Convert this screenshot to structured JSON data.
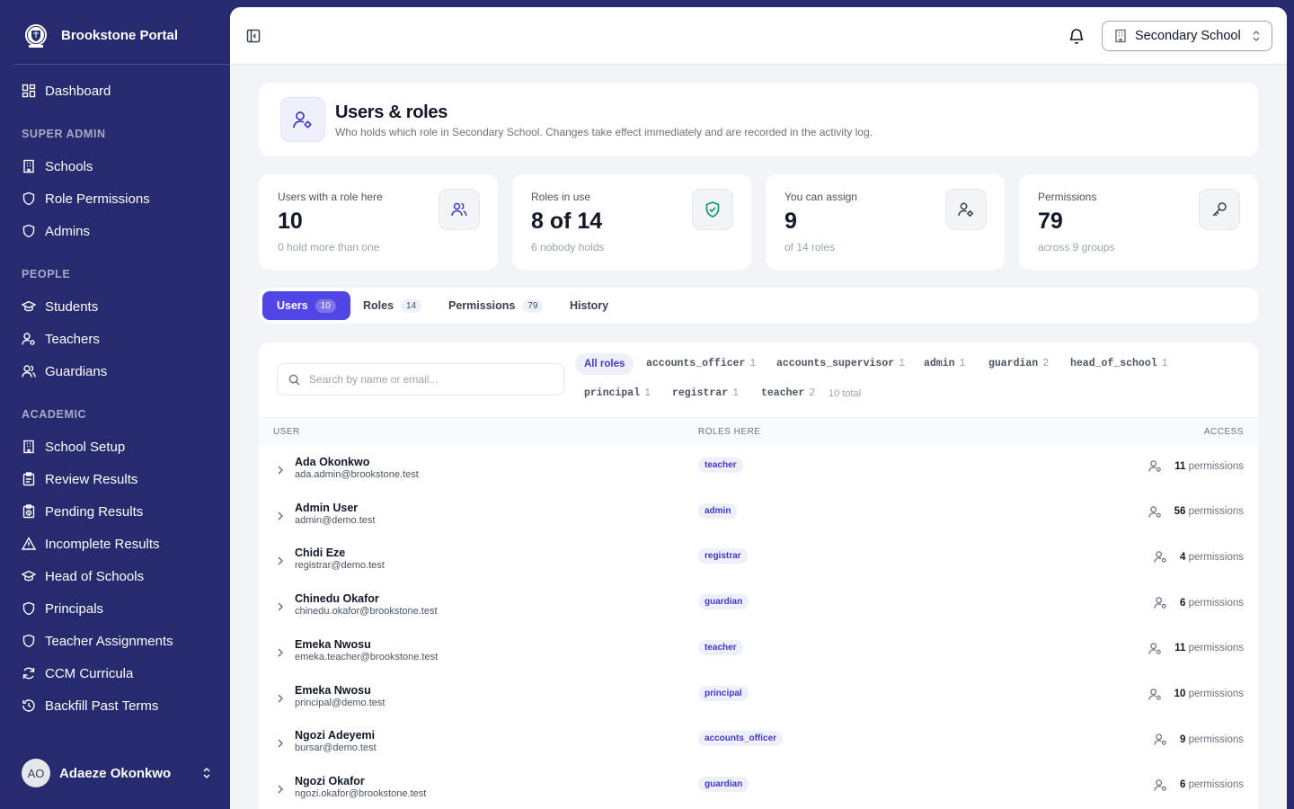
{
  "brand": {
    "name": "Brookstone Portal"
  },
  "sidebar": {
    "dashboard": "Dashboard",
    "sections": {
      "super_admin": "SUPER ADMIN",
      "people": "PEOPLE",
      "academic": "ACADEMIC"
    },
    "super_admin_items": [
      "Schools",
      "Role Permissions",
      "Admins"
    ],
    "people_items": [
      "Students",
      "Teachers",
      "Guardians"
    ],
    "academic_items": [
      "School Setup",
      "Review Results",
      "Pending Results",
      "Incomplete Results",
      "Head of Schools",
      "Principals",
      "Teacher Assignments",
      "CCM Curricula",
      "Backfill Past Terms"
    ]
  },
  "current_user": {
    "initials": "AO",
    "name": "Adaeze Okonkwo"
  },
  "topbar": {
    "school": "Secondary School"
  },
  "page": {
    "title": "Users & roles",
    "subtitle": "Who holds which role in Secondary School. Changes take effect immediately and are recorded in the activity log."
  },
  "stats": [
    {
      "label": "Users with a role here",
      "value": "10",
      "sub": "0 hold more than one"
    },
    {
      "label": "Roles in use",
      "value": "8 of 14",
      "sub": "6 nobody holds"
    },
    {
      "label": "You can assign",
      "value": "9",
      "sub": "of 14 roles"
    },
    {
      "label": "Permissions",
      "value": "79",
      "sub": "across 9 groups"
    }
  ],
  "tabs": [
    {
      "label": "Users",
      "count": "10"
    },
    {
      "label": "Roles",
      "count": "14"
    },
    {
      "label": "Permissions",
      "count": "79"
    },
    {
      "label": "History",
      "count": ""
    }
  ],
  "filters": {
    "search_placeholder": "Search by name or email...",
    "all_roles": "All roles",
    "roles": [
      {
        "name": "accounts_officer",
        "count": "1"
      },
      {
        "name": "accounts_supervisor",
        "count": "1"
      },
      {
        "name": "admin",
        "count": "1"
      },
      {
        "name": "guardian",
        "count": "2"
      },
      {
        "name": "head_of_school",
        "count": "1"
      },
      {
        "name": "principal",
        "count": "1"
      },
      {
        "name": "registrar",
        "count": "1"
      },
      {
        "name": "teacher",
        "count": "2"
      }
    ],
    "total": "10 total"
  },
  "table": {
    "headers": {
      "user": "USER",
      "roles": "ROLES HERE",
      "access": "ACCESS"
    },
    "permissions_word": "permissions",
    "rows": [
      {
        "name": "Ada Okonkwo",
        "email": "ada.admin@brookstone.test",
        "role": "teacher",
        "permissions": "11"
      },
      {
        "name": "Admin User",
        "email": "admin@demo.test",
        "role": "admin",
        "permissions": "56"
      },
      {
        "name": "Chidi Eze",
        "email": "registrar@demo.test",
        "role": "registrar",
        "permissions": "4"
      },
      {
        "name": "Chinedu Okafor",
        "email": "chinedu.okafor@brookstone.test",
        "role": "guardian",
        "permissions": "6"
      },
      {
        "name": "Emeka Nwosu",
        "email": "emeka.teacher@brookstone.test",
        "role": "teacher",
        "permissions": "11"
      },
      {
        "name": "Emeka Nwosu",
        "email": "principal@demo.test",
        "role": "principal",
        "permissions": "10"
      },
      {
        "name": "Ngozi Adeyemi",
        "email": "bursar@demo.test",
        "role": "accounts_officer",
        "permissions": "9"
      },
      {
        "name": "Ngozi Okafor",
        "email": "ngozi.okafor@brookstone.test",
        "role": "guardian",
        "permissions": "6"
      }
    ]
  },
  "colors": {
    "sidebar": "#262a6e",
    "accent": "#4f46e5",
    "background": "#f3f4f8"
  }
}
